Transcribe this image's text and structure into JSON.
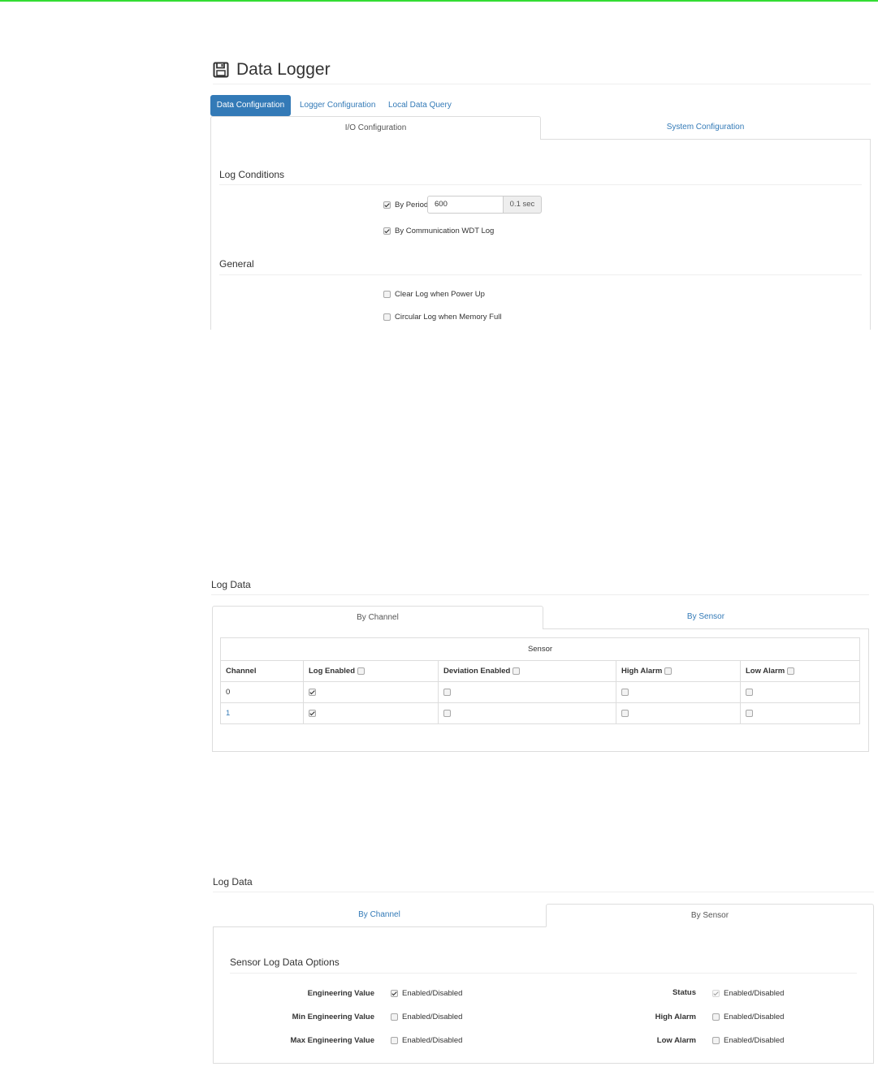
{
  "header": {
    "title": "Data Logger",
    "icon": "floppy-disk-icon"
  },
  "main_tabs": [
    {
      "label": "Data Configuration",
      "active": true
    },
    {
      "label": "Logger Configuration",
      "active": false
    },
    {
      "label": "Local Data Query",
      "active": false
    }
  ],
  "sub_tabs": [
    {
      "label": "I/O Configuration",
      "active": true
    },
    {
      "label": "System Configuration",
      "active": false
    }
  ],
  "log_conditions": {
    "heading": "Log Conditions",
    "by_period_label": "By Period",
    "by_period_checked": true,
    "period_value": "600",
    "period_unit": "0.1 sec",
    "wdt_label": "By Communication WDT Log",
    "wdt_checked": true
  },
  "general": {
    "heading": "General",
    "clear_log_label": "Clear Log when Power Up",
    "circular_log_label": "Circular Log when Memory Full"
  },
  "log_data_channel": {
    "heading": "Log Data",
    "tabs": [
      "By Channel",
      "By Sensor"
    ],
    "table_caption": "Sensor",
    "columns": [
      "Channel",
      "Log Enabled",
      "Deviation Enabled",
      "High Alarm",
      "Low Alarm"
    ],
    "rows": [
      {
        "channel": "0",
        "log": true,
        "deviation": false,
        "high": false,
        "low": false
      },
      {
        "channel": "1",
        "log": true,
        "deviation": false,
        "high": false,
        "low": false
      }
    ]
  },
  "log_data_sensor": {
    "heading": "Log Data",
    "tabs": [
      "By Channel",
      "By Sensor"
    ],
    "options_heading": "Sensor Log Data Options",
    "enabled_text": "Enabled/Disabled",
    "left": [
      {
        "label": "Engineering Value",
        "checked": true
      },
      {
        "label": "Min Engineering Value",
        "checked": false
      },
      {
        "label": "Max Engineering Value",
        "checked": false
      }
    ],
    "right": [
      {
        "label": "Status",
        "checked": true
      },
      {
        "label": "High Alarm",
        "checked": false
      },
      {
        "label": "Low Alarm",
        "checked": false
      }
    ]
  },
  "colors": {
    "primary": "#337ab7",
    "border": "#dddddd",
    "top_line": "#33dd33"
  }
}
